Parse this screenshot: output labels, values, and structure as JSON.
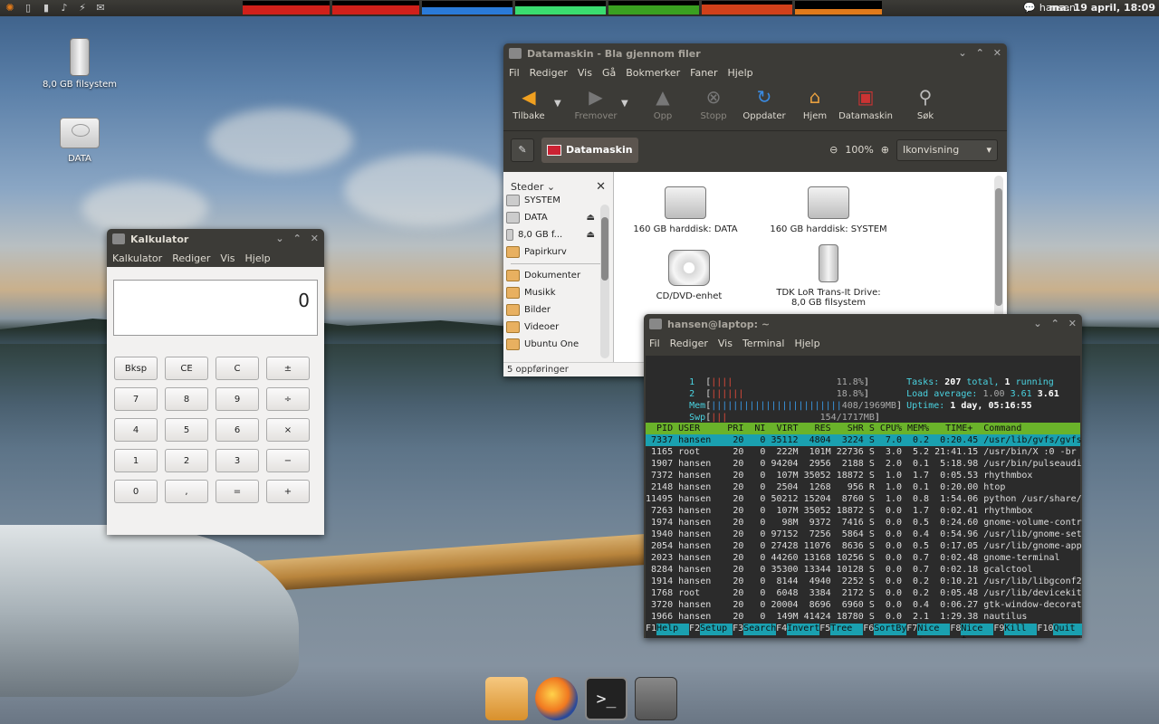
{
  "top_panel": {
    "icons": [
      "usb-tray-icon",
      "phone-tray-icon",
      "volume-icon",
      "network-icon",
      "mail-icon"
    ],
    "user": "hansen",
    "clock": "ma. 19 april, 18:09",
    "graph_colors": [
      "#d0201a",
      "#d0201a",
      "#2a7ad8",
      "#3adc70",
      "#3aa020",
      "#d0401a",
      "#e07a1a"
    ]
  },
  "desktop": {
    "icons": [
      {
        "label": "8,0 GB filsystem",
        "kind": "usb-drive-icon"
      },
      {
        "label": "DATA",
        "kind": "hard-drive-icon"
      }
    ]
  },
  "nautilus": {
    "title": "Datamaskin - Bla gjennom filer",
    "menu": [
      "Fil",
      "Rediger",
      "Vis",
      "Gå",
      "Bokmerker",
      "Faner",
      "Hjelp"
    ],
    "toolbar": {
      "back": "Tilbake",
      "forward": "Fremover",
      "up": "Opp",
      "stop": "Stopp",
      "reload": "Oppdater",
      "home": "Hjem",
      "computer": "Datamaskin",
      "search": "Søk"
    },
    "location": "Datamaskin",
    "zoom": "100%",
    "view": "Ikonvisning",
    "sidebar": {
      "header": "Steder",
      "items": [
        {
          "label": "SYSTEM",
          "eject": false
        },
        {
          "label": "DATA",
          "eject": true
        },
        {
          "label": "8,0 GB f...",
          "eject": true
        },
        {
          "label": "Papirkurv",
          "eject": false
        }
      ],
      "bookmarks": [
        {
          "label": "Dokumenter"
        },
        {
          "label": "Musikk"
        },
        {
          "label": "Bilder"
        },
        {
          "label": "Videoer"
        },
        {
          "label": "Ubuntu One"
        }
      ]
    },
    "files": [
      {
        "label": "160 GB harddisk: DATA",
        "kind": "hdd"
      },
      {
        "label": "160 GB harddisk: SYSTEM",
        "kind": "hdd"
      },
      {
        "label": "CD/DVD-enhet",
        "kind": "cd"
      },
      {
        "label": "TDK LoR Trans-It Drive: 8,0 GB filsystem",
        "kind": "usb"
      }
    ],
    "status": "5 oppføringer"
  },
  "calculator": {
    "title": "Kalkulator",
    "menu": [
      "Kalkulator",
      "Rediger",
      "Vis",
      "Hjelp"
    ],
    "display": "0",
    "buttons": [
      "Bksp",
      "CE",
      "C",
      "±",
      "7",
      "8",
      "9",
      "÷",
      "4",
      "5",
      "6",
      "×",
      "1",
      "2",
      "3",
      "−",
      "0",
      ",",
      "=",
      "+"
    ]
  },
  "terminal": {
    "title": "hansen@laptop: ~",
    "menu": [
      "Fil",
      "Rediger",
      "Vis",
      "Terminal",
      "Hjelp"
    ],
    "meters": {
      "cpu1_label": "1",
      "cpu1_bar": "||||",
      "cpu1_val": "11.8%",
      "cpu2_label": "2",
      "cpu2_bar": "||||||",
      "cpu2_val": "18.8%",
      "mem_label": "Mem",
      "mem_bar": "||||||||||||||||||||||||",
      "mem_val": "408/1969MB",
      "swp_label": "Swp",
      "swp_bar": "|||",
      "swp_val": "154/1717MB"
    },
    "summary": {
      "tasks_label": "Tasks:",
      "tasks": "207",
      "tasks_total": "total,",
      "running": "1",
      "running_label": "running",
      "load_label": "Load average:",
      "load1": "1.00",
      "load5": "3.61",
      "load15": "3.61",
      "uptime_label": "Uptime:",
      "uptime": "1 day, 05:16:55"
    },
    "columns": "  PID USER     PRI  NI  VIRT   RES   SHR S CPU% MEM%   TIME+  Command",
    "rows": [
      " 7337 hansen    20   0 35112  4804  3224 S  7.0  0.2  0:20.45 /usr/lib/gvfs/gvfs",
      " 1165 root      20   0  222M  101M 22736 S  3.0  5.2 21:41.15 /usr/bin/X :0 -br",
      " 1907 hansen    20   0 94204  2956  2188 S  2.0  0.1  5:18.98 /usr/bin/pulseaudi",
      " 7372 hansen    20   0  107M 35052 18872 S  1.0  1.7  0:05.53 rhythmbox",
      " 2148 hansen    20   0  2504  1268   956 R  1.0  0.1  0:20.00 htop",
      "11495 hansen    20   0 50212 15204  8760 S  1.0  0.8  1:54.06 python /usr/share/",
      " 7263 hansen    20   0  107M 35052 18872 S  0.0  1.7  0:02.41 rhythmbox",
      " 1974 hansen    20   0   98M  9372  7416 S  0.0  0.5  0:24.60 gnome-volume-contr",
      " 1940 hansen    20   0 97152  7256  5864 S  0.0  0.4  0:54.96 /usr/lib/gnome-set",
      " 2054 hansen    20   0 27428 11076  8636 S  0.0  0.5  0:17.05 /usr/lib/gnome-app",
      " 2023 hansen    20   0 44260 13168 10256 S  0.0  0.7  0:02.48 gnome-terminal",
      " 8284 hansen    20   0 35300 13344 10128 S  0.0  0.7  0:02.18 gcalctool",
      " 1914 hansen    20   0  8144  4940  2252 S  0.0  0.2  0:10.21 /usr/lib/libgconf2",
      " 1768 root      20   0  6048  3384  2172 S  0.0  0.2  0:05.48 /usr/lib/devicekit",
      " 3720 hansen    20   0 20004  8696  6960 S  0.0  0.4  0:06.27 gtk-window-decorat",
      " 1966 hansen    20   0  149M 41424 18780 S  0.0  2.1  1:29.38 nautilus"
    ],
    "fkeys": [
      {
        "num": "F1",
        "label": "Help"
      },
      {
        "num": "F2",
        "label": "Setup"
      },
      {
        "num": "F3",
        "label": "Search"
      },
      {
        "num": "F4",
        "label": "Invert"
      },
      {
        "num": "F5",
        "label": "Tree"
      },
      {
        "num": "F6",
        "label": "SortBy"
      },
      {
        "num": "F7",
        "label": "Nice -"
      },
      {
        "num": "F8",
        "label": "Nice +"
      },
      {
        "num": "F9",
        "label": "Kill"
      },
      {
        "num": "F10",
        "label": "Quit"
      }
    ]
  },
  "dock": {
    "items": [
      "file-manager-icon",
      "firefox-icon",
      "terminal-icon",
      "calculator-icon"
    ],
    "terminal_glyph": ">_"
  }
}
